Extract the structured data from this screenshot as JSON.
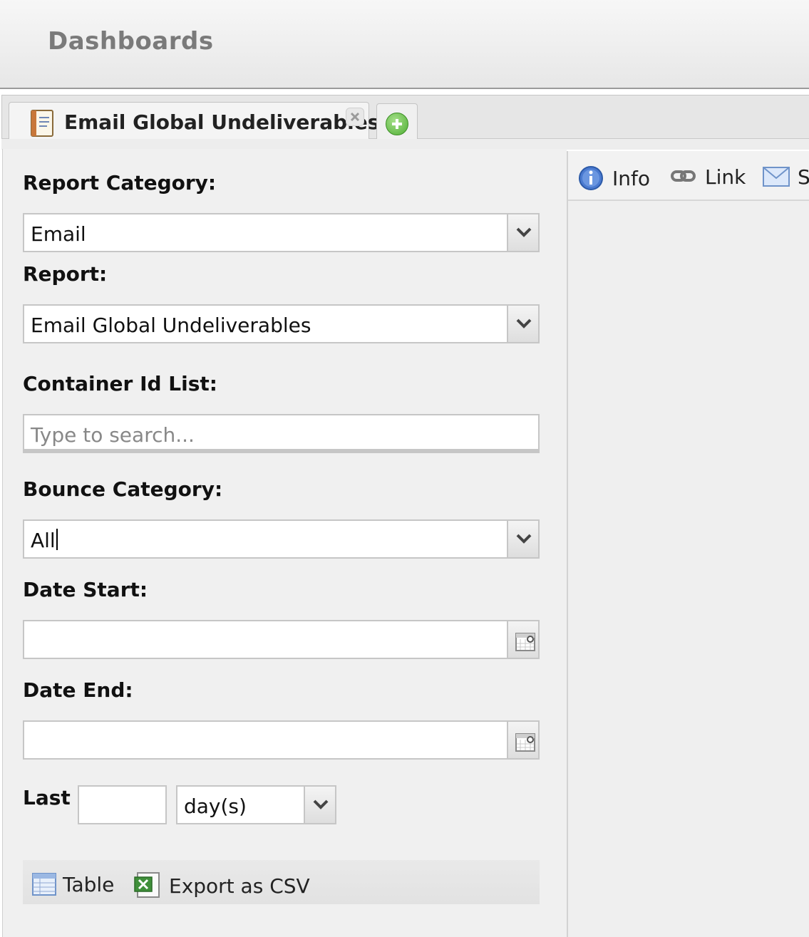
{
  "header": {
    "title": "Dashboards"
  },
  "tabs": [
    {
      "label": "Email Global Undeliverables",
      "icon": "report-document-icon",
      "closable": true
    }
  ],
  "add_tab_icon": "add-tab-icon",
  "form": {
    "report_category": {
      "label": "Report Category:",
      "value": "Email"
    },
    "report": {
      "label": "Report:",
      "value": "Email Global Undeliverables"
    },
    "container_id_list": {
      "label": "Container Id List:",
      "placeholder": "Type to search..."
    },
    "bounce_category": {
      "label": "Bounce Category:",
      "value": "All"
    },
    "date_start": {
      "label": "Date Start:",
      "value": ""
    },
    "date_end": {
      "label": "Date End:",
      "value": ""
    },
    "last": {
      "label": "Last",
      "value": "",
      "unit": "day(s)"
    }
  },
  "actions": {
    "table_label": "Table",
    "export_label": "Export as CSV"
  },
  "right_toolbar": {
    "info_label": "Info",
    "link_label": "Link",
    "send_label": "S"
  }
}
